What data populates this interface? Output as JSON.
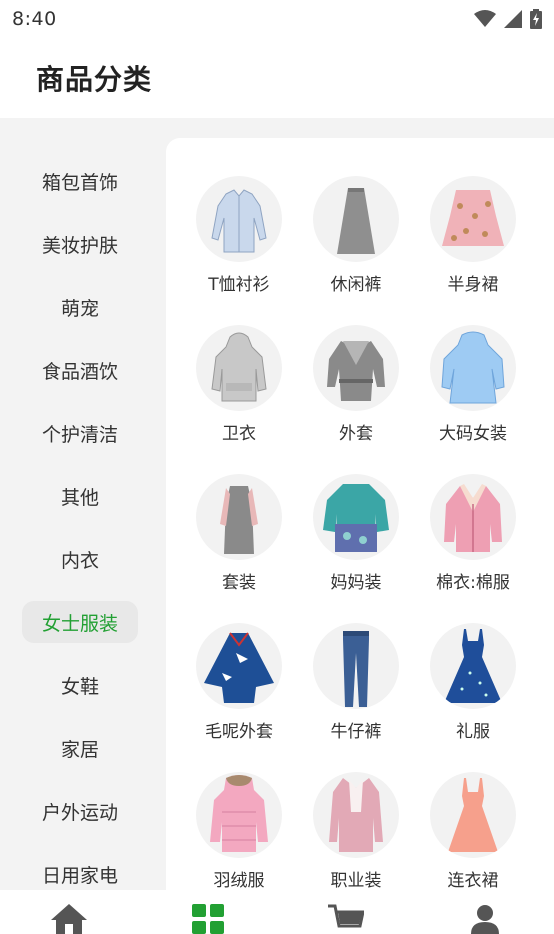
{
  "status_bar": {
    "time": "8:40",
    "icons": [
      "wifi-icon",
      "signal-icon",
      "battery-charging-icon"
    ]
  },
  "header": {
    "title": "商品分类"
  },
  "sidebar": {
    "items": [
      {
        "label": "箱包首饰"
      },
      {
        "label": "美妆护肤"
      },
      {
        "label": "萌宠"
      },
      {
        "label": "食品酒饮"
      },
      {
        "label": "个护清洁"
      },
      {
        "label": "其他"
      },
      {
        "label": "内衣"
      },
      {
        "label": "女士服装",
        "active": true
      },
      {
        "label": "女鞋"
      },
      {
        "label": "家居"
      },
      {
        "label": "户外运动"
      },
      {
        "label": "日用家电"
      }
    ]
  },
  "categories": [
    {
      "label": "T恤衬衫",
      "image": "shirt-image"
    },
    {
      "label": "休闲裤",
      "image": "skirt-gray-image"
    },
    {
      "label": "半身裙",
      "image": "floral-skirt-image"
    },
    {
      "label": "卫衣",
      "image": "hoodie-image"
    },
    {
      "label": "外套",
      "image": "coat-gray-image"
    },
    {
      "label": "大码女装",
      "image": "blue-top-image"
    },
    {
      "label": "套装",
      "image": "dress-set-image"
    },
    {
      "label": "妈妈装",
      "image": "teal-blouse-image"
    },
    {
      "label": "棉衣:棉服",
      "image": "pink-jacket-image"
    },
    {
      "label": "毛呢外套",
      "image": "blue-cape-image"
    },
    {
      "label": "牛仔裤",
      "image": "jeans-image"
    },
    {
      "label": "礼服",
      "image": "evening-dress-image"
    },
    {
      "label": "羽绒服",
      "image": "pink-down-jacket-image"
    },
    {
      "label": "职业装",
      "image": "blazer-image"
    },
    {
      "label": "连衣裙",
      "image": "peach-dress-image"
    }
  ],
  "bottom_nav": [
    {
      "name": "home",
      "icon": "home-icon"
    },
    {
      "name": "category",
      "icon": "grid-icon",
      "active": true
    },
    {
      "name": "cart",
      "icon": "cart-icon"
    },
    {
      "name": "profile",
      "icon": "user-icon"
    }
  ],
  "colors": {
    "accent": "#22a033",
    "nav_icon": "#555555",
    "sidebar_bg": "#f3f3f3",
    "active_bg": "#e8e8e8"
  }
}
